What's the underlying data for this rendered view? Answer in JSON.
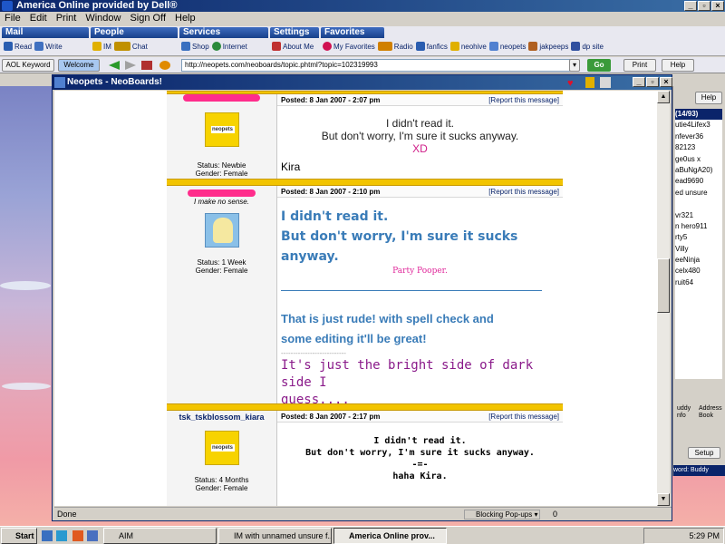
{
  "app": {
    "title": "America  Online provided by Dell®"
  },
  "menu": [
    "File",
    "Edit",
    "Print",
    "Window",
    "Sign Off",
    "Help"
  ],
  "toolbar_groups": [
    {
      "label": "Mail",
      "items": [
        "Read",
        "Write"
      ]
    },
    {
      "label": "People",
      "items": [
        "IM",
        "Chat"
      ]
    },
    {
      "label": "Services",
      "items": [
        "Shop",
        "Internet"
      ]
    },
    {
      "label": "Settings",
      "items": [
        "About Me"
      ]
    },
    {
      "label": "Favorites",
      "items": [
        "My Favorites",
        "Radio",
        "fanfics",
        "neohive",
        "neopets",
        "jakpeeps",
        "dp site"
      ]
    }
  ],
  "address": {
    "aol_keyword": "AOL Keyword",
    "welcome": "Welcome",
    "url": "http://neopets.com/neoboards/topic.phtml?topic=102319993",
    "go": "Go",
    "print": "Print",
    "help": "Help"
  },
  "window": {
    "title": "Neopets - NeoBoards!"
  },
  "posts": [
    {
      "username": "",
      "tagline": "",
      "status": "Status: Newbie",
      "gender": "Gender: Female",
      "posted": "Posted: 8 Jan 2007 - 2:07 pm",
      "report": "[Report this message]",
      "line1": "I didn't read it.",
      "line2": "But don't worry, I'm sure it sucks anyway.",
      "xd": "XD",
      "sig": "Kira"
    },
    {
      "username": "",
      "tagline": "I make no sense.",
      "status": "Status: 1 Week",
      "gender": "Gender: Female",
      "posted": "Posted: 8 Jan 2007 - 2:10 pm",
      "report": "[Report this message]",
      "line1": "I didn't read it.",
      "line2": "But don't worry, I'm sure it sucks anyway.",
      "party": "Party Pooper.",
      "rude1": "That is just rude! with spell check and",
      "rude2": "some editing it'll be great!",
      "dashes": "---------------------------",
      "bright1": "It's just the bright side of dark side I",
      "bright2": "guess...."
    },
    {
      "username": "tsk_tskblossom_kiara",
      "status": "Status: 4 Months",
      "gender": "Gender: Female",
      "posted": "Posted: 8 Jan 2007 - 2:17 pm",
      "report": "[Report this message]",
      "line1": "I didn't read it.",
      "line2": "But don't worry, I'm sure it sucks anyway.",
      "line3": "-=-",
      "line4": "haha Kira."
    }
  ],
  "statusbar": {
    "text": "Done",
    "popups": "Blocking Pop-ups",
    "count": "0"
  },
  "chat": {
    "help": "Help",
    "count": "(14/93)",
    "buddies": [
      "utie4Lifex3",
      "nfever36",
      "82123",
      "ge0us x",
      "aBuNgA20)",
      "ead9690",
      "ed unsure",
      "",
      "vr321",
      "n hero911",
      "rty5",
      "Villy",
      "eeNinja",
      "celx480",
      "ruit64"
    ],
    "buddy_info": "uddy nfo",
    "address_book": "Address Book",
    "setup": "Setup",
    "keyword": "word: Buddy"
  },
  "taskbar": {
    "start": "Start",
    "tasks": [
      "AIM",
      "IM with unnamed unsure f...",
      "America  Online prov..."
    ],
    "clock": "5:29 PM"
  },
  "colors": {
    "aol_blue": "#0a246a",
    "neo_yellow": "#f2c400",
    "post_blue": "#3a7cb8",
    "purple": "#8a1a8a",
    "pink": "#e0279a"
  }
}
